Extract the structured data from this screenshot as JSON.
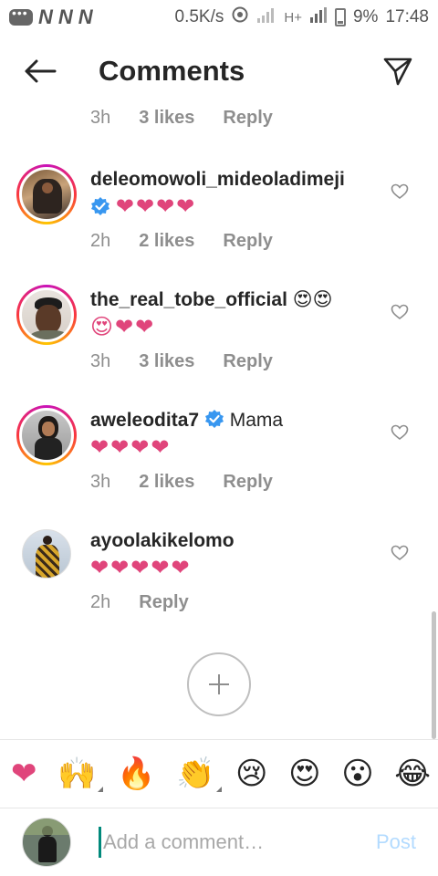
{
  "status_bar": {
    "carrier_letters": [
      "N",
      "N",
      "N"
    ],
    "speed": "0.5K/s",
    "network": "H+",
    "battery": "9%",
    "time": "17:48"
  },
  "header": {
    "title": "Comments"
  },
  "top_partial": {
    "time": "3h",
    "likes": "3 likes",
    "reply": "Reply"
  },
  "comments": [
    {
      "username": "deleomowoli_mideoladimeji",
      "verified": true,
      "text_line1": "",
      "text_line2": "❤❤❤❤",
      "time": "2h",
      "likes": "2 likes",
      "reply": "Reply"
    },
    {
      "username": "the_real_tobe_official",
      "verified": false,
      "text_line1": "😍😍",
      "text_line2": "😍❤❤",
      "time": "3h",
      "likes": "3 likes",
      "reply": "Reply"
    },
    {
      "username": "aweleodita7",
      "verified": true,
      "text_line1": "Mama",
      "text_line2": "❤❤❤❤",
      "time": "3h",
      "likes": "2 likes",
      "reply": "Reply"
    },
    {
      "username": "ayoolakikelomo",
      "verified": false,
      "text_line1": "",
      "text_line2": "❤❤❤❤❤",
      "time": "2h",
      "likes": "",
      "reply": "Reply"
    }
  ],
  "emoji_bar": [
    "❤",
    "🙌",
    "🔥",
    "👏",
    "😢",
    "😍",
    "😮",
    "😂"
  ],
  "input": {
    "placeholder": "Add a comment…",
    "post_label": "Post"
  },
  "colors": {
    "heart": "#e0457b",
    "verified": "#3897f0",
    "post_disabled": "#b3dbff",
    "meta": "#8e8e8e"
  }
}
